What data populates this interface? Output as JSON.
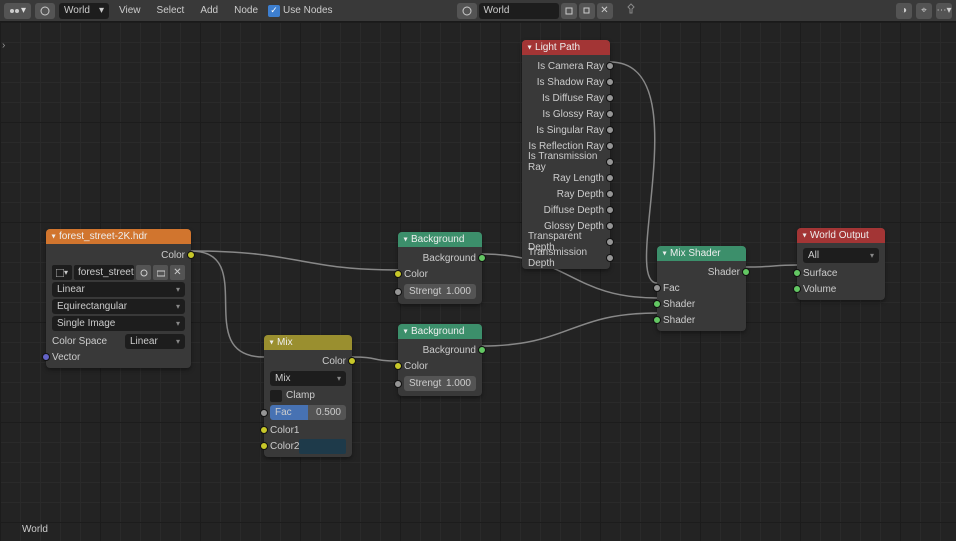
{
  "toolbar": {
    "editor_icon": "node-editor",
    "world_dd": "World",
    "menus": [
      "View",
      "Select",
      "Add",
      "Node"
    ],
    "use_nodes": "Use Nodes",
    "mid_world": "World",
    "pin": "Pin"
  },
  "nodes": {
    "env_tex": {
      "title": "forest_street-2K.hdr",
      "out_color": "Color",
      "file": "forest_street-...",
      "interp": "Linear",
      "proj": "Equirectangular",
      "img_mode": "Single Image",
      "colorspace_lbl": "Color Space",
      "colorspace_val": "Linear",
      "in_vector": "Vector"
    },
    "mix": {
      "title": "Mix",
      "out_color": "Color",
      "blend": "Mix",
      "clamp": "Clamp",
      "fac_lbl": "Fac",
      "fac_val": "0.500",
      "in_color1": "Color1",
      "in_color2": "Color2"
    },
    "bg1": {
      "title": "Background",
      "out": "Background",
      "in_color": "Color",
      "strength_lbl": "Strengt",
      "strength_val": "1.000"
    },
    "bg2": {
      "title": "Background",
      "out": "Background",
      "in_color": "Color",
      "strength_lbl": "Strengt",
      "strength_val": "1.000"
    },
    "lightpath": {
      "title": "Light Path",
      "outputs": [
        "Is Camera Ray",
        "Is Shadow Ray",
        "Is Diffuse Ray",
        "Is Glossy Ray",
        "Is Singular Ray",
        "Is Reflection Ray",
        "Is Transmission Ray",
        "Ray Length",
        "Ray Depth",
        "Diffuse Depth",
        "Glossy Depth",
        "Transparent Depth",
        "Transmission Depth"
      ]
    },
    "mixshader": {
      "title": "Mix Shader",
      "out": "Shader",
      "in_fac": "Fac",
      "in_shader1": "Shader",
      "in_shader2": "Shader"
    },
    "worldout": {
      "title": "World Output",
      "target": "All",
      "in_surface": "Surface",
      "in_volume": "Volume"
    }
  },
  "breadcrumb": "World"
}
